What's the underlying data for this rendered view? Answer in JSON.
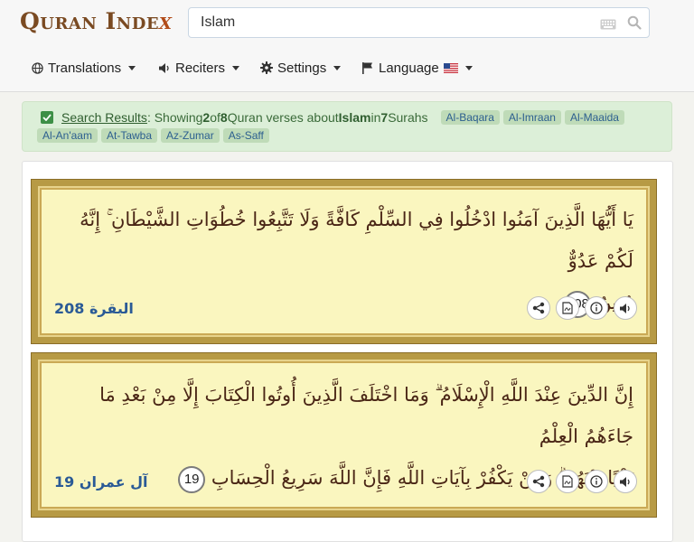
{
  "logo": {
    "main": "Quran Inde",
    "x": "x"
  },
  "search": {
    "value": "Islam",
    "placeholder": ""
  },
  "nav": {
    "translations": "Translations",
    "reciters": "Reciters",
    "settings": "Settings",
    "language": "Language"
  },
  "banner": {
    "link": "Search Results",
    "t1": ": Showing ",
    "shown": "2",
    "t2": " of ",
    "total": "8",
    "t3": " Quran verses about ",
    "query": "Islam",
    "t4": " in ",
    "surah_count": "7",
    "t5": " Surahs",
    "tags": [
      "Al-Baqara",
      "Al-Imraan",
      "Al-Maaida",
      "Al-An'aam",
      "At-Tawba",
      "Az-Zumar",
      "As-Saff"
    ]
  },
  "verses": [
    {
      "line1": "يَا أَيُّهَا الَّذِينَ آمَنُوا ادْخُلُوا فِي السِّلْمِ كَافَّةً وَلَا تَتَّبِعُوا خُطُوَاتِ الشَّيْطَانِ ۚ إِنَّهُ لَكُمْ عَدُوٌّ",
      "line2": "مُبِينٌ",
      "num": "208",
      "ref": "البقرة 208"
    },
    {
      "line1": "إِنَّ الدِّينَ عِنْدَ اللَّهِ الْإِسْلَامُ ۗ وَمَا اخْتَلَفَ الَّذِينَ أُوتُوا الْكِتَابَ إِلَّا مِنْ بَعْدِ مَا جَاءَهُمُ الْعِلْمُ",
      "line2": "بَغْيًا بَيْنَهُمْ ۗ وَمَنْ يَكْفُرْ بِآيَاتِ اللَّهِ فَإِنَّ اللَّهَ سَرِيعُ الْحِسَابِ",
      "num": "19",
      "ref": "آل عمران 19"
    }
  ],
  "colors": {
    "accent": "#2a5a96",
    "banner_bg": "#dcefd8",
    "verse_bg": "#faf6bf"
  }
}
